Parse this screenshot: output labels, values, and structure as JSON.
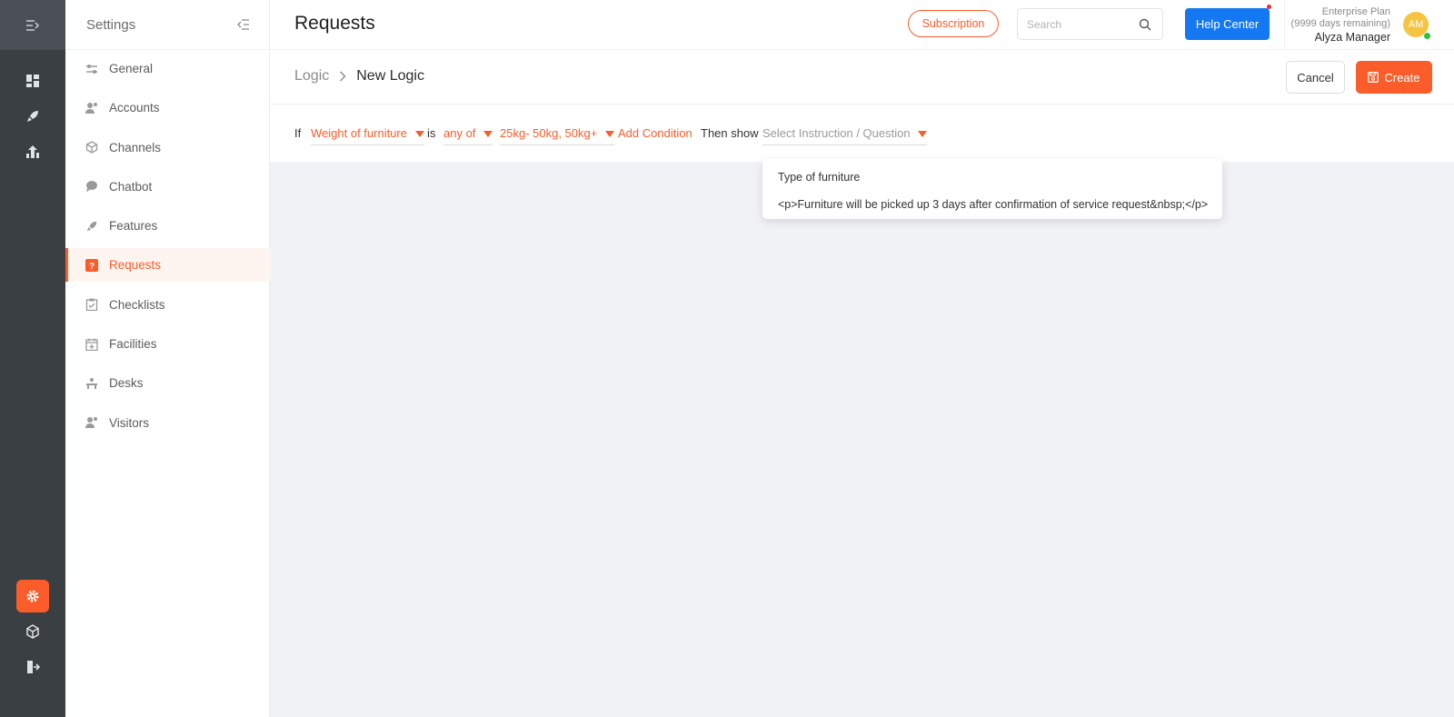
{
  "rail": {
    "items": [
      {
        "icon": "dashboard-icon"
      },
      {
        "icon": "rocket-icon"
      },
      {
        "icon": "building-chart-icon"
      }
    ],
    "bottom": [
      {
        "icon": "gear-icon",
        "active": true
      },
      {
        "icon": "cube-icon"
      },
      {
        "icon": "logout-icon"
      }
    ]
  },
  "settings": {
    "title": "Settings",
    "items": [
      {
        "label": "General",
        "icon": "sliders-icon"
      },
      {
        "label": "Accounts",
        "icon": "users-icon"
      },
      {
        "label": "Channels",
        "icon": "box-icon"
      },
      {
        "label": "Chatbot",
        "icon": "chat-bubble-icon"
      },
      {
        "label": "Features",
        "icon": "rocket-icon"
      },
      {
        "label": "Requests",
        "icon": "question-square-icon",
        "active": true
      },
      {
        "label": "Checklists",
        "icon": "clipboard-check-icon"
      },
      {
        "label": "Facilities",
        "icon": "calendar-plus-icon"
      },
      {
        "label": "Desks",
        "icon": "desk-icon"
      },
      {
        "label": "Visitors",
        "icon": "visitor-icon"
      }
    ]
  },
  "header": {
    "title": "Requests",
    "subscription_label": "Subscription",
    "search_placeholder": "Search",
    "help_label": "Help Center",
    "plan_name": "Enterprise Plan",
    "plan_remaining": "(9999 days remaining)",
    "user_name": "Alyza Manager",
    "avatar_initials": "AM"
  },
  "breadcrumb": {
    "parent": "Logic",
    "current": "New Logic",
    "cancel_label": "Cancel",
    "create_label": "Create"
  },
  "condition": {
    "if_label": "If",
    "field": "Weight of furniture",
    "is_label": "is",
    "operator": "any of",
    "values": "25kg- 50kg, 50kg+",
    "add_condition": "Add Condition",
    "then_label": "Then show",
    "select_placeholder": "Select Instruction / Question"
  },
  "dropdown": {
    "options": [
      "Type of furniture",
      "<p>Furniture will be picked up 3 days after confirmation of service request&nbsp;</p>"
    ]
  },
  "colors": {
    "accent": "#fa5c2a",
    "primary": "#1478f2",
    "rail_bg": "#3a3f44",
    "content_bg": "#f1f2f5"
  }
}
